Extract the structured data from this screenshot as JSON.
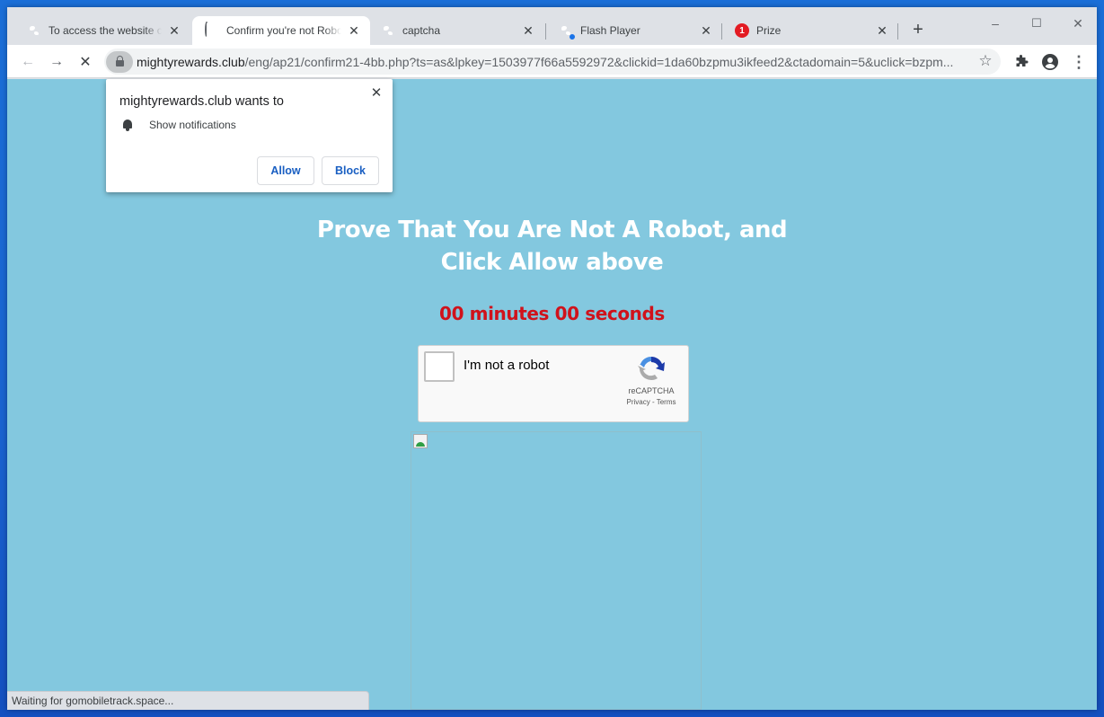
{
  "browser": {
    "tabs": [
      {
        "title": "To access the website click",
        "favicon": "globe-icon",
        "active": false
      },
      {
        "title": "Confirm you're not Robot",
        "favicon": "loading-spinner-icon",
        "active": true
      },
      {
        "title": "captcha",
        "favicon": "globe-icon",
        "active": false
      },
      {
        "title": "Flash Player",
        "favicon": "globe-icon",
        "active": false
      },
      {
        "title": "Prize",
        "favicon": "notification-badge-icon",
        "badge": "1",
        "active": false
      }
    ],
    "new_tab": "+",
    "window_controls": {
      "minimize": "–",
      "maximize": "☐",
      "close": "✕"
    },
    "toolbar": {
      "back": "←",
      "forward": "→",
      "stop": "✕",
      "url_host": "mightyrewards.club",
      "url_path": "/eng/ap21/confirm21-4bb.php?ts=as&lpkey=1503977f66a5592972&clickid=1da60bzpmu3ikfeed2&ctadomain=5&uclick=bzpm...",
      "bookmark_star": "☆",
      "menu": "⋮"
    },
    "status_bar": "Waiting for gomobiletrack.space..."
  },
  "permission_popup": {
    "title": "mightyrewards.club wants to",
    "permission": "Show notifications",
    "allow_label": "Allow",
    "block_label": "Block",
    "close": "✕"
  },
  "page": {
    "headline_line1": "Prove That You Are Not A Robot, and",
    "headline_line2": "Click Allow above",
    "timer": "00 minutes 00 seconds",
    "captcha": {
      "label": "I'm not a robot",
      "brand": "reCAPTCHA",
      "links": "Privacy - Terms",
      "checked": false
    }
  },
  "colors": {
    "page_background": "#83c8df",
    "headline": "#ffffff",
    "timer": "#d0121b",
    "button_text": "#1a5fc2",
    "desktop": "#1a63d0"
  }
}
